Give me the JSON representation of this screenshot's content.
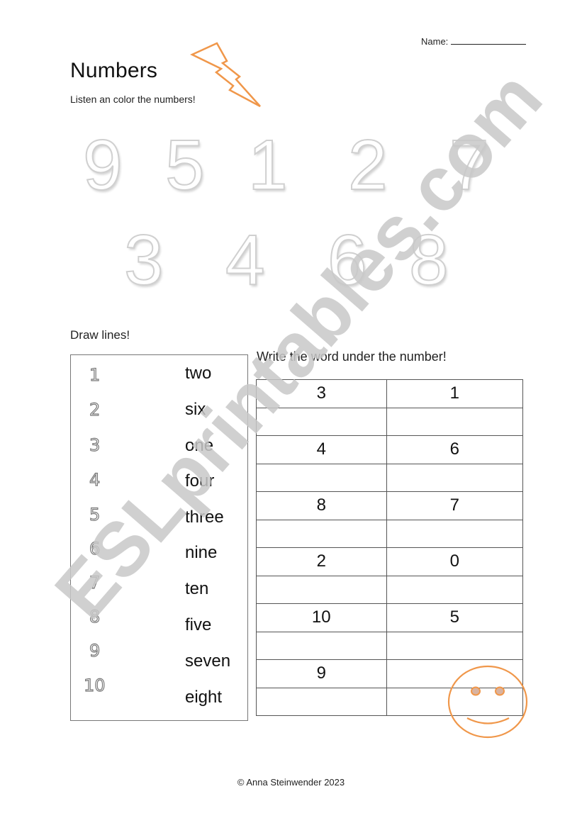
{
  "header": {
    "name_label": "Name:",
    "title": "Numbers",
    "subtitle": "Listen an color the numbers!"
  },
  "coloring_digits": {
    "row1": [
      "9",
      "5",
      "1",
      "2",
      "7"
    ],
    "row2": [
      "3",
      "4",
      "6",
      "8"
    ]
  },
  "draw_lines": {
    "label": "Draw lines!",
    "numbers": [
      "1",
      "2",
      "3",
      "4",
      "5",
      "6",
      "7",
      "8",
      "9",
      "10"
    ],
    "words": [
      "two",
      "six",
      "one",
      "four",
      "three",
      "nine",
      "ten",
      "five",
      "seven",
      "eight"
    ]
  },
  "write_words": {
    "label": "Write the word under the number!",
    "rows": [
      [
        "3",
        "1"
      ],
      [
        "",
        ""
      ],
      [
        "4",
        "6"
      ],
      [
        "",
        ""
      ],
      [
        "8",
        "7"
      ],
      [
        "",
        ""
      ],
      [
        "2",
        "0"
      ],
      [
        "",
        ""
      ],
      [
        "10",
        "5"
      ],
      [
        "",
        ""
      ],
      [
        "9",
        ""
      ],
      [
        "",
        ""
      ]
    ]
  },
  "decorations": {
    "accent_color": "#f0974a",
    "watermark_text": "ESLprintables.com",
    "watermark_color": "#c8c8c8"
  },
  "footer": {
    "copyright": "© Anna Steinwender 2023"
  }
}
